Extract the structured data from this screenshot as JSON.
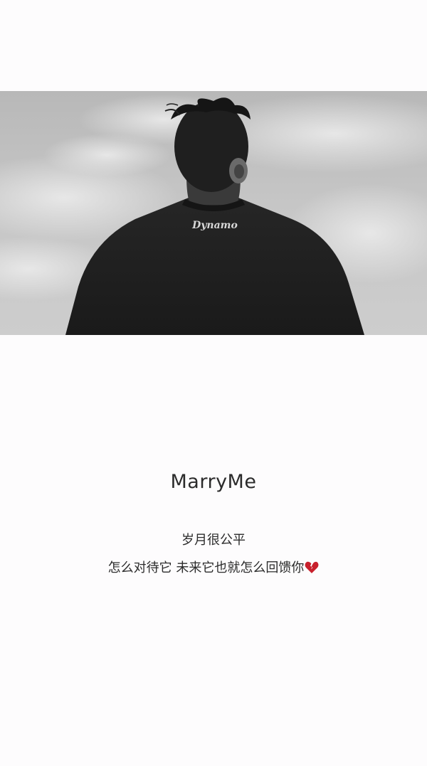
{
  "post": {
    "title": "MarryMe",
    "line1": "岁月很公平",
    "line2": "怎么对待它 未来它也就怎么回馈你",
    "shirt_logo_text": "Dynamo"
  },
  "icons": {
    "trailing_emoji": "broken-heart-icon"
  },
  "colors": {
    "background": "#fdfcfd",
    "text": "#2b2b2b",
    "heart": "#c8202c"
  }
}
